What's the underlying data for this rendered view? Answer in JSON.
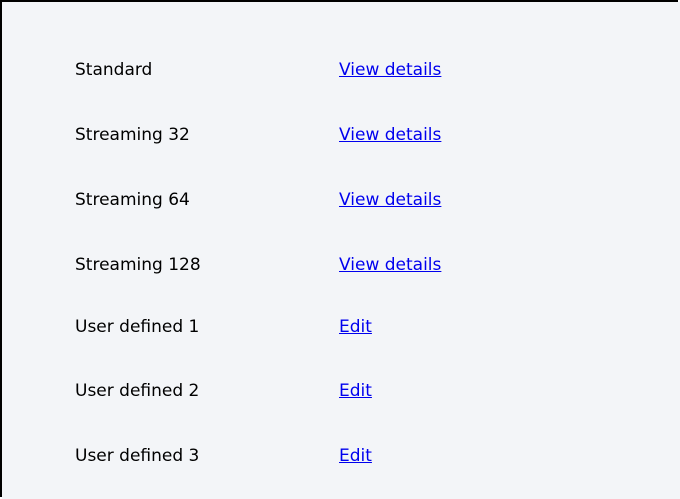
{
  "profiles": [
    {
      "name": "Standard",
      "action": "View details"
    },
    {
      "name": "Streaming 32",
      "action": "View details"
    },
    {
      "name": "Streaming 64",
      "action": "View details"
    },
    {
      "name": "Streaming 128",
      "action": "View details"
    },
    {
      "name": "User defined 1",
      "action": "Edit"
    },
    {
      "name": "User defined 2",
      "action": "Edit"
    },
    {
      "name": "User defined 3",
      "action": "Edit"
    }
  ],
  "colors": {
    "background": "#f3f5f8",
    "link": "#0000ee",
    "text": "#000000"
  }
}
